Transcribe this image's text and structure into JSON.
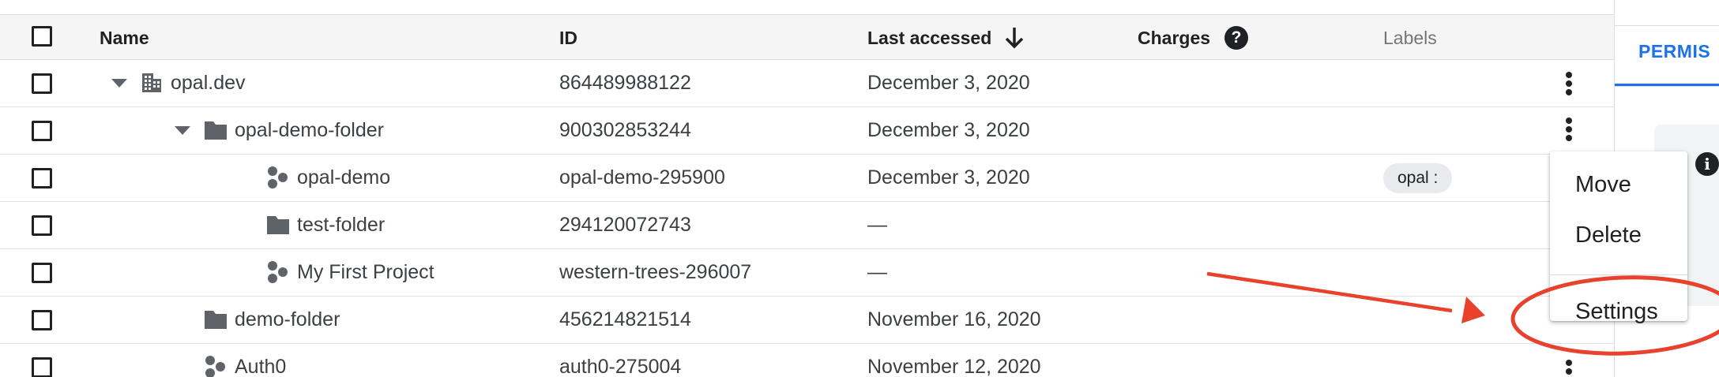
{
  "header": {
    "name": "Name",
    "id": "ID",
    "last_accessed": "Last accessed",
    "charges": "Charges",
    "labels": "Labels"
  },
  "rows": [
    {
      "name": "opal.dev",
      "id": "864489988122",
      "last_accessed": "December 3, 2020",
      "icon": "organization-icon",
      "expanded": true
    },
    {
      "name": "opal-demo-folder",
      "id": "900302853244",
      "last_accessed": "December 3, 2020",
      "icon": "folder-icon",
      "expanded": true
    },
    {
      "name": "opal-demo",
      "id": "opal-demo-295900",
      "last_accessed": "December 3, 2020",
      "icon": "project-icon",
      "label": "opal :"
    },
    {
      "name": "test-folder",
      "id": "294120072743",
      "last_accessed": "—",
      "icon": "folder-icon"
    },
    {
      "name": "My First Project",
      "id": "western-trees-296007",
      "last_accessed": "—",
      "icon": "project-icon"
    },
    {
      "name": "demo-folder",
      "id": "456214821514",
      "last_accessed": "November 16, 2020",
      "icon": "folder-icon"
    },
    {
      "name": "Auth0",
      "id": "auth0-275004",
      "last_accessed": "November 12, 2020",
      "icon": "project-icon"
    }
  ],
  "context_menu": {
    "items": [
      "Move",
      "Delete",
      "Settings"
    ]
  },
  "right_panel": {
    "tab_label": "PERMIS"
  },
  "colors": {
    "annotation": "#e8412c",
    "accent": "#1a73e8"
  }
}
